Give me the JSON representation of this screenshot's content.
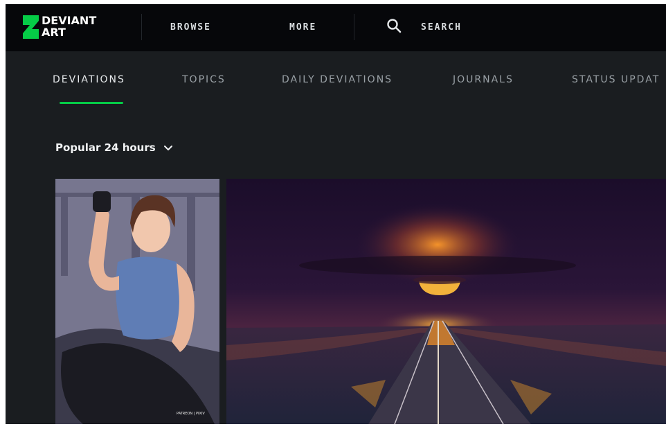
{
  "header": {
    "logo_line1": "DEVIANT",
    "logo_line2": "ART",
    "nav": [
      {
        "label": "BROWSE"
      },
      {
        "label": "MORE"
      }
    ],
    "search_label": "SEARCH"
  },
  "tabs": [
    {
      "label": "DEVIATIONS",
      "active": true
    },
    {
      "label": "TOPICS",
      "active": false
    },
    {
      "label": "DAILY DEVIATIONS",
      "active": false
    },
    {
      "label": "JOURNALS",
      "active": false
    },
    {
      "label": "STATUS UPDAT",
      "active": false
    }
  ],
  "filter": {
    "label": "Popular 24 hours"
  },
  "colors": {
    "brand_green": "#05cc47",
    "topbar_bg": "#06070a",
    "page_bg": "#1a1d20"
  },
  "icons": [
    "deviantart-logo-icon",
    "search-icon",
    "chevron-down-icon"
  ]
}
